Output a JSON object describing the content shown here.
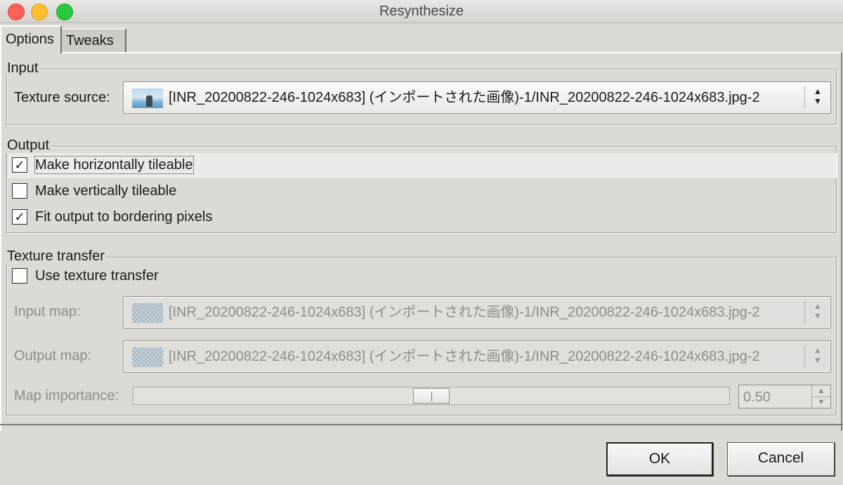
{
  "window": {
    "title": "Resynthesize"
  },
  "tabs": [
    {
      "label": "Options",
      "active": true
    },
    {
      "label": "Tweaks",
      "active": false
    }
  ],
  "input": {
    "section_label": "Input",
    "texture_source_label": "Texture source:",
    "texture_source_value": "[INR_20200822-246-1024x683] (インポートされた画像)-1/INR_20200822-246-1024x683.jpg-2"
  },
  "output": {
    "section_label": "Output",
    "options": [
      {
        "label": "Make horizontally tileable",
        "checked": true
      },
      {
        "label": "Make vertically tileable",
        "checked": false
      },
      {
        "label": "Fit output to bordering pixels",
        "checked": true
      }
    ]
  },
  "texture_transfer": {
    "section_label": "Texture transfer",
    "use_label": "Use texture transfer",
    "use_checked": false,
    "input_map_label": "Input map:",
    "input_map_value": "[INR_20200822-246-1024x683] (インポートされた画像)-1/INR_20200822-246-1024x683.jpg-2",
    "output_map_label": "Output map:",
    "output_map_value": "[INR_20200822-246-1024x683] (インポートされた画像)-1/INR_20200822-246-1024x683.jpg-2",
    "map_importance_label": "Map importance:",
    "map_importance_value": "0.50"
  },
  "buttons": {
    "ok": "OK",
    "cancel": "Cancel"
  },
  "icons": {
    "updown": "updown-arrows-icon",
    "check": "✓",
    "spin_up": "▲",
    "spin_down": "▼"
  }
}
